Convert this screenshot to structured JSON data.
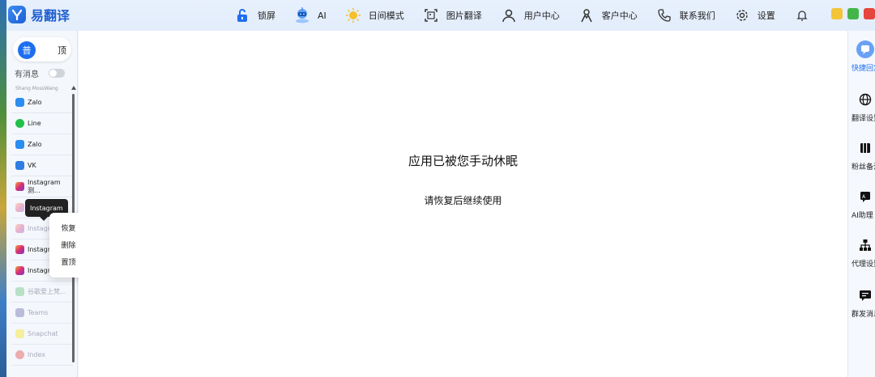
{
  "app": {
    "name": "易翻译"
  },
  "nav": [
    {
      "label": "锁屏",
      "icon": "lock-icon"
    },
    {
      "label": "AI",
      "icon": "robot-icon"
    },
    {
      "label": "日间模式",
      "icon": "sun-icon"
    },
    {
      "label": "图片翻译",
      "icon": "image-translate-icon"
    },
    {
      "label": "用户中心",
      "icon": "user-icon"
    },
    {
      "label": "客户中心",
      "icon": "customer-icon"
    },
    {
      "label": "联系我们",
      "icon": "phone-icon"
    },
    {
      "label": "设置",
      "icon": "gear-icon"
    }
  ],
  "window_buttons": {
    "minimize_color": "#f2c438",
    "maximize_color": "#43b649",
    "close_color": "#e5463d"
  },
  "sidebar": {
    "segment": {
      "left": "普",
      "right": "顶"
    },
    "message_toggle_label": "有消息",
    "apps": [
      {
        "label": "Shang MossWang",
        "icon": "zalo-icon"
      },
      {
        "label": "Zalo",
        "icon": "zalo-icon"
      },
      {
        "label": "Line",
        "icon": "line-icon"
      },
      {
        "label": "Zalo",
        "icon": "zalo-icon"
      },
      {
        "label": "VK",
        "icon": "vk-icon"
      },
      {
        "label": "Instagram测...",
        "icon": "instagram-icon"
      },
      {
        "label": "",
        "icon": "instagram-icon"
      },
      {
        "label": "Instagr",
        "icon": "instagram-icon"
      },
      {
        "label": "Instagra",
        "icon": "instagram-icon"
      },
      {
        "label": "Instagra",
        "icon": "instagram-icon"
      },
      {
        "label": "谷歌爱上梵...",
        "icon": "chat-icon"
      },
      {
        "label": "Teams",
        "icon": "teams-icon"
      },
      {
        "label": "Snapchat",
        "icon": "snapchat-icon"
      },
      {
        "label": "Index",
        "icon": "toggle-icon"
      }
    ],
    "tooltip": "Instagram",
    "context_menu": [
      "恢复",
      "删除",
      "置顶"
    ]
  },
  "main": {
    "title": "应用已被您手动休眠",
    "subtitle": "请恢复后继续使用"
  },
  "right_panel": [
    {
      "label": "快捷回复",
      "icon": "quick-reply-icon",
      "active": true
    },
    {
      "label": "翻译设置",
      "icon": "globe-icon"
    },
    {
      "label": "粉丝备注",
      "icon": "notes-icon"
    },
    {
      "label": "AI助理",
      "icon": "ai-assistant-icon"
    },
    {
      "label": "代理设置",
      "icon": "proxy-icon"
    },
    {
      "label": "群发消息",
      "icon": "broadcast-icon"
    }
  ]
}
